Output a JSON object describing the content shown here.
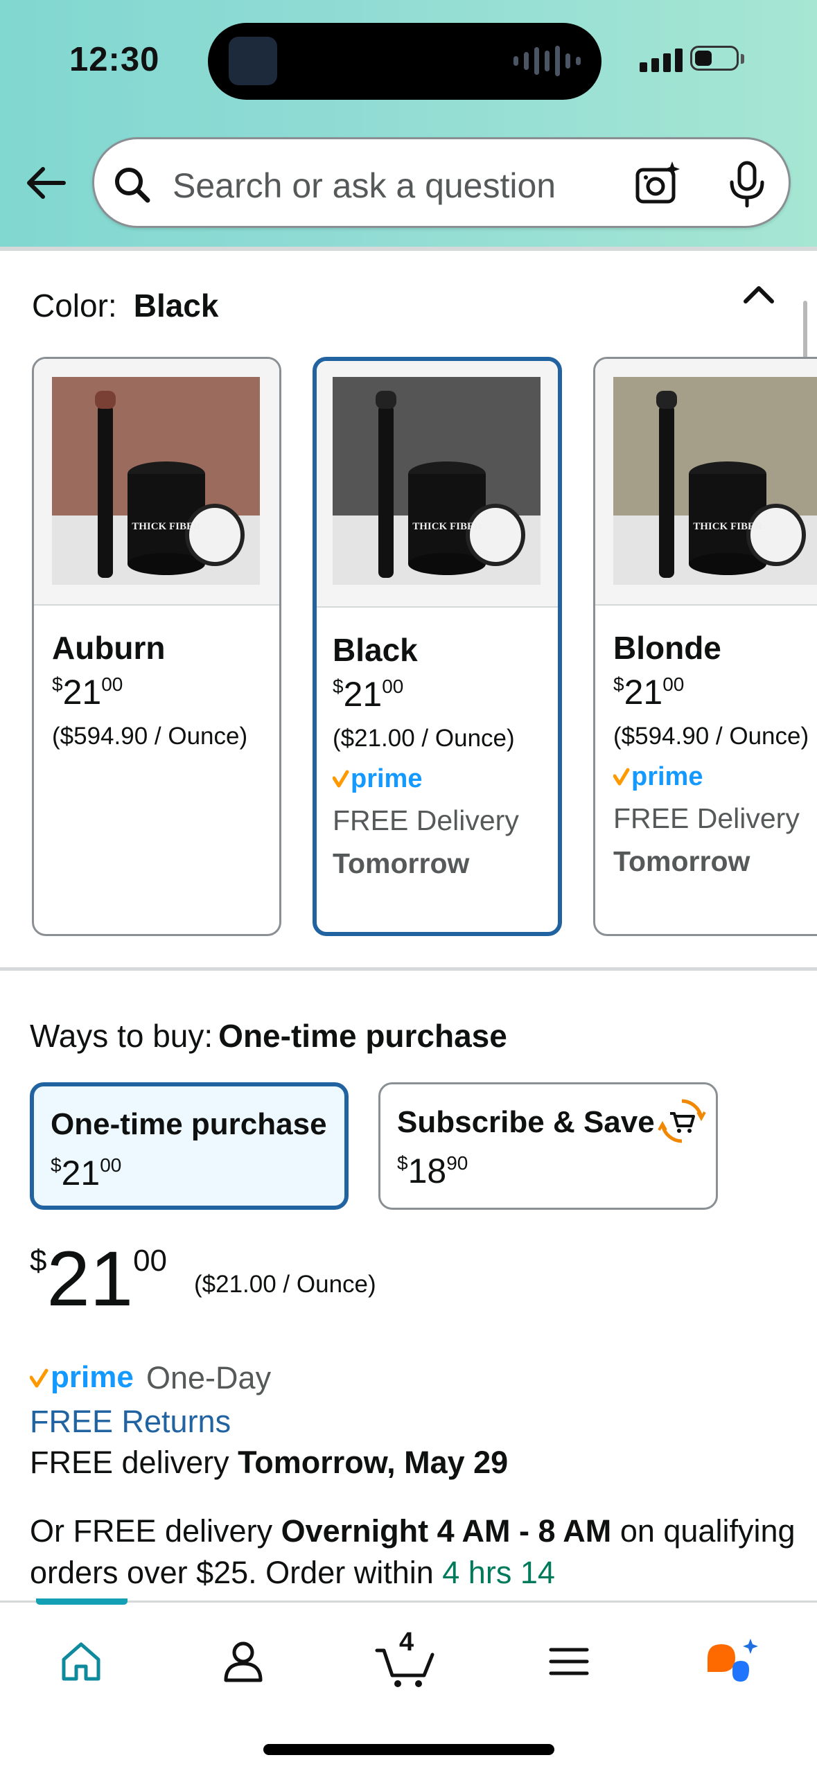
{
  "status_bar": {
    "time": "12:30"
  },
  "search": {
    "placeholder": "Search or ask a question"
  },
  "color_selector": {
    "label": "Color:",
    "selected_value": "Black",
    "variants": [
      {
        "name": "Auburn",
        "price_whole": "21",
        "price_fraction": "00",
        "currency": "$",
        "unit_price": "($594.90 / Ounce)",
        "prime": false,
        "delivery_label": "",
        "delivery_day": "",
        "photo_bg": "#9b6b5e"
      },
      {
        "name": "Black",
        "price_whole": "21",
        "price_fraction": "00",
        "currency": "$",
        "unit_price": "($21.00 / Ounce)",
        "prime": true,
        "delivery_label": "FREE Delivery",
        "delivery_day": "Tomorrow",
        "photo_bg": "#555555"
      },
      {
        "name": "Blonde",
        "price_whole": "21",
        "price_fraction": "00",
        "currency": "$",
        "unit_price": "($594.90 / Ounce)",
        "prime": true,
        "delivery_label": "FREE Delivery",
        "delivery_day": "Tomorrow",
        "photo_bg": "#a59f8a"
      }
    ],
    "product_text": "THICK FIBER"
  },
  "ways_to_buy": {
    "label": "Ways to buy:",
    "selected": "One-time purchase",
    "options": [
      {
        "title": "One-time purchase",
        "currency": "$",
        "price_whole": "21",
        "price_fraction": "00"
      },
      {
        "title": "Subscribe & Save",
        "currency": "$",
        "price_whole": "18",
        "price_fraction": "90"
      }
    ]
  },
  "price": {
    "currency": "$",
    "whole": "21",
    "fraction": "00",
    "unit_price": "($21.00 / Ounce)"
  },
  "delivery": {
    "prime_label": "prime",
    "one_day": "One-Day",
    "free_returns": "FREE Returns",
    "free_delivery_prefix": "FREE delivery",
    "free_delivery_date": "Tomorrow, May 29",
    "overnight_prefix": "Or FREE delivery",
    "overnight_window": "Overnight 4 AM - 8 AM",
    "overnight_suffix": "on qualifying orders over $25. Order within",
    "countdown": "4 hrs 14"
  },
  "bottom_nav": {
    "items": [
      "home",
      "account",
      "cart",
      "menu",
      "rufus"
    ],
    "cart_count": "4"
  },
  "colors": {
    "accent_blue": "#2162a1",
    "prime_blue": "#1399ff",
    "prime_check": "#ff9900",
    "countdown_green": "#007a5a",
    "header_teal": "#81d8d0"
  }
}
